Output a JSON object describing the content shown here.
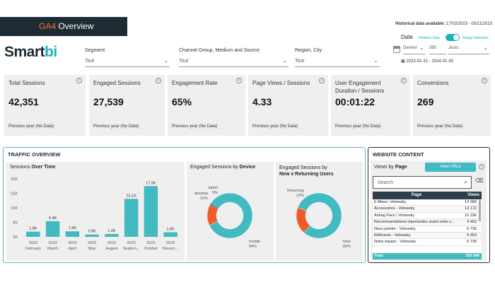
{
  "header": {
    "title_prefix": "GA4",
    "title_rest": " Overview",
    "logo_a": "Smart",
    "logo_b": "bi"
  },
  "filters": {
    "segment": {
      "label": "Segment",
      "value": "Tout"
    },
    "channel": {
      "label": "Channel Group, Medium and Source",
      "value": "Tout"
    },
    "region": {
      "label": "Region, City",
      "value": "Tout"
    }
  },
  "date_panel": {
    "historical_label": "Historical data available:",
    "historical_range": "17/02/2023 - 05/11/2023",
    "date_label": "Date",
    "relative_label": "Relative Date",
    "range_label": "Range Selection",
    "period": "Dernier",
    "count": "365",
    "unit": "Jours",
    "range": "2023-01-31 - 2024-01-30"
  },
  "kpis": [
    {
      "title": "Total Sessions",
      "value": "42,351",
      "prev": "Previous year (No Data)"
    },
    {
      "title": "Engaged Sessions",
      "value": "27,539",
      "prev": "Previous year (No Data)"
    },
    {
      "title": "Engagement Rate",
      "value": "65%",
      "prev": "Previous year (No Data)"
    },
    {
      "title": "Page Views / Sessions",
      "value": "4.33",
      "prev": "Previous year (No Data)"
    },
    {
      "title": "User Engagement Duration / Sessions",
      "value": "00:01:22",
      "prev": "Previous year (No Data)"
    },
    {
      "title": "Conversions",
      "value": "269",
      "prev": "Previous year (No Data)"
    }
  ],
  "traffic": {
    "section_title": "TRAFFIC OVERVIEW",
    "sessions_title_a": "Sessions ",
    "sessions_title_b": "Over Time",
    "device_title_a": "Engaged Sessions by ",
    "device_title_b": "Device",
    "nvr_title_a": "Engaged Sessions by",
    "nvr_title_b": "New v Returning Users"
  },
  "chart_data": [
    {
      "type": "bar",
      "title": "Sessions Over Time",
      "categories": [
        "2023 February",
        "2023 March",
        "2023 April",
        "2023 May",
        "2023 August",
        "2023 Septem...",
        "2023 October",
        "2023 Novem..."
      ],
      "values": [
        1800,
        5400,
        1900,
        800,
        1000,
        13100,
        17500,
        1600
      ],
      "data_labels": [
        "1.8K",
        "5.4K",
        "1.9K",
        "0.8K",
        "1.0K",
        "13.1K",
        "17.5K",
        "1.6K"
      ],
      "yticks": [
        "20K",
        "15K",
        "10K",
        "5K",
        "0K"
      ],
      "ylim": [
        0,
        20000
      ],
      "color": "#41bac1"
    },
    {
      "type": "pie",
      "title": "Engaged Sessions by Device",
      "slices": [
        {
          "name": "mobile",
          "label": "84%",
          "value": 84,
          "color": "#41bac1"
        },
        {
          "name": "desktop",
          "label": "15%",
          "value": 15,
          "color": "#f05a28"
        },
        {
          "name": "tablet",
          "label": "0%",
          "value": 1,
          "color": "#2c3e4a"
        }
      ]
    },
    {
      "type": "pie",
      "title": "Engaged Sessions by New v Returning Users",
      "slices": [
        {
          "name": "New",
          "label": "80%",
          "value": 80,
          "color": "#41bac1"
        },
        {
          "name": "Returning",
          "label": "19%",
          "value": 19,
          "color": "#f05a28"
        }
      ]
    }
  ],
  "website": {
    "section_title": "WEBSITE CONTENT",
    "views_by_a": "Views by ",
    "views_by_b": "Page",
    "view_urls": "View URLs",
    "search_placeholder": "Search",
    "col_page": "Page",
    "col_views": "Views",
    "rows": [
      {
        "page": "E-Bikes- Velowsky",
        "views": "14 968"
      },
      {
        "page": "Accessoires - Velowsky",
        "views": "12 172"
      },
      {
        "page": "Airbag Pack | Velowsky",
        "views": "10 336"
      },
      {
        "page": "Recommandations importantes avant votre v...",
        "views": "9 402"
      },
      {
        "page": "Nous joindre - Velowsky",
        "views": "6 736"
      },
      {
        "page": "Référents - Velowsky",
        "views": "6 553"
      },
      {
        "page": "Notre équipe - Velowsky",
        "views": "5 730"
      }
    ],
    "total_label": "Total",
    "total_value": "183 540"
  },
  "colors": {
    "accent": "#41bac1",
    "orange": "#f05a28",
    "dark": "#1f2b33"
  }
}
